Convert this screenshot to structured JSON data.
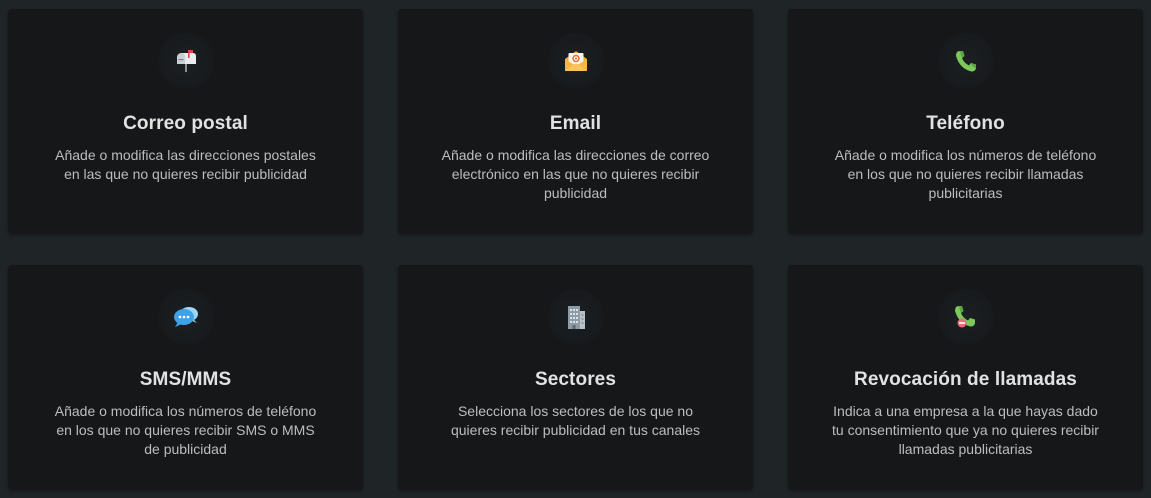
{
  "cards": [
    {
      "title": "Correo postal",
      "description": "Añade o modifica las direcciones postales en las que no quieres recibir publicidad",
      "icon": "mailbox-icon"
    },
    {
      "title": "Email",
      "description": "Añade o modifica las direcciones de correo electrónico en las que no quieres recibir publicidad",
      "icon": "email-icon"
    },
    {
      "title": "Teléfono",
      "description": "Añade o modifica los números de teléfono en los que no quieres recibir llamadas publicitarias",
      "icon": "phone-icon"
    },
    {
      "title": "SMS/MMS",
      "description": "Añade o modifica los números de teléfono en los que no quieres recibir SMS o MMS de publicidad",
      "icon": "chat-bubbles-icon"
    },
    {
      "title": "Sectores",
      "description": "Selecciona los sectores de los que no quieres recibir publicidad en tus canales",
      "icon": "building-icon"
    },
    {
      "title": "Revocación de llamadas",
      "description": "Indica a una empresa a la que hayas dado tu consentimiento que ya no quieres recibir llamadas publicitarias",
      "icon": "phone-revoke-icon"
    }
  ],
  "colors": {
    "page_background": "#1f2426",
    "card_background": "#151719",
    "title_text": "#e2e2e2",
    "description_text": "#bdbdbd"
  }
}
